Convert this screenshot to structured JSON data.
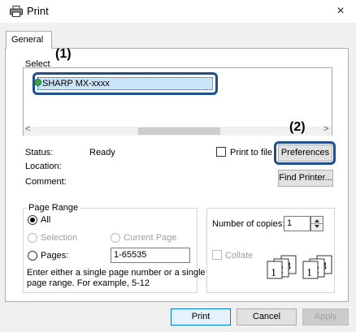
{
  "window": {
    "title": "Print",
    "close": "×"
  },
  "tabs": [
    {
      "label": "General"
    }
  ],
  "select_printer": {
    "label": "Select",
    "annotation": "(1)",
    "printers": [
      {
        "name": "SHARP MX-xxxx"
      }
    ],
    "scroll_left": "<",
    "scroll_right": ">"
  },
  "status": {
    "status_label": "Status:",
    "status_value": "Ready",
    "location_label": "Location:",
    "comment_label": "Comment:"
  },
  "print_to_file": {
    "label": "Print to file",
    "checked": false
  },
  "preferences": {
    "label": "Preferences",
    "annotation": "(2)"
  },
  "find_printer": {
    "label": "Find Printer..."
  },
  "page_range": {
    "title": "Page Range",
    "all": "All",
    "selection": "Selection",
    "current_page": "Current Page",
    "pages": "Pages:",
    "pages_value": "1-65535",
    "hint_line1": "Enter either a single page number or a single",
    "hint_line2": "page range.  For example, 5-12"
  },
  "copies": {
    "label": "Number of copies:",
    "value": "1",
    "collate": "Collate",
    "collate_checked": false
  },
  "collate_pages": [
    "1",
    "2",
    "3"
  ],
  "buttons": {
    "print": "Print",
    "cancel": "Cancel",
    "apply": "Apply"
  },
  "colors": {
    "highlight": "#1f4e8c",
    "selection_bg": "#cce4f7",
    "accent": "#0078d7"
  },
  "icons": [
    "printer-icon",
    "close-icon",
    "printer-status-icon",
    "spinner-arrows-icon"
  ]
}
